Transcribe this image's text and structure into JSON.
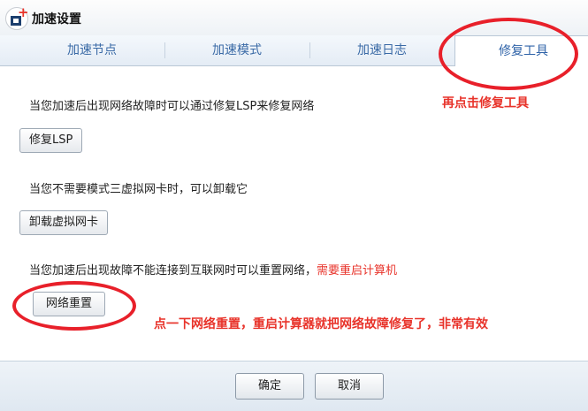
{
  "window": {
    "title": "加速设置"
  },
  "tabs": [
    "加速节点",
    "加速模式",
    "加速日志",
    "修复工具"
  ],
  "active_tab": "修复工具",
  "sections": {
    "lsp_text": "当您加速后出现网络故障时可以通过修复LSP来修复网络",
    "lsp_button": "修复LSP",
    "nic_text": "当您不需要模式三虚拟网卡时，可以卸载它",
    "nic_button": "卸载虚拟网卡",
    "reset_text": "当您加速后出现故障不能连接到互联网时可以重置网络，",
    "reset_warning": "需要重启计算机",
    "reset_button": "网络重置"
  },
  "annotations": {
    "tab_hint": "再点击修复工具",
    "reset_hint": "点一下网络重置，重启计算器就把网络故障修复了，非常有效"
  },
  "footer": {
    "ok": "确定",
    "cancel": "取消"
  },
  "colors": {
    "accent_red": "#e8332a",
    "tab_text": "#3a6aa6"
  },
  "icons": {
    "app": "app-logo-icon"
  }
}
